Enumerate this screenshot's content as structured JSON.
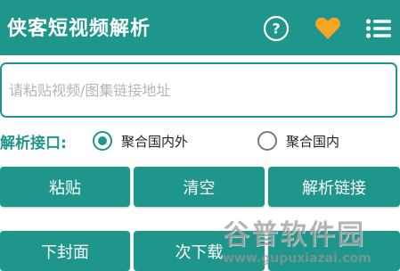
{
  "header": {
    "title": "侠客短视频解析",
    "icons": [
      "help-icon",
      "heart-icon",
      "menu-icon"
    ],
    "background": "#1e968c"
  },
  "url_input": {
    "placeholder": "请粘贴视频/图集链接地址",
    "value": ""
  },
  "api_select": {
    "label": "解析接口:",
    "options": [
      {
        "label": "聚合国内外",
        "checked": true
      },
      {
        "label": "聚合国内",
        "checked": false
      }
    ]
  },
  "buttons": {
    "paste": "粘贴",
    "clear": "清空",
    "parse": "解析链接",
    "cover": "下封面",
    "next": "次下载",
    "third": ""
  },
  "watermark": {
    "logo": "谷普软件园",
    "url": "www.gupuxiazai.com"
  },
  "colors": {
    "accent": "#1e968c",
    "heart": "#f5a623",
    "text_dark": "#222222"
  }
}
